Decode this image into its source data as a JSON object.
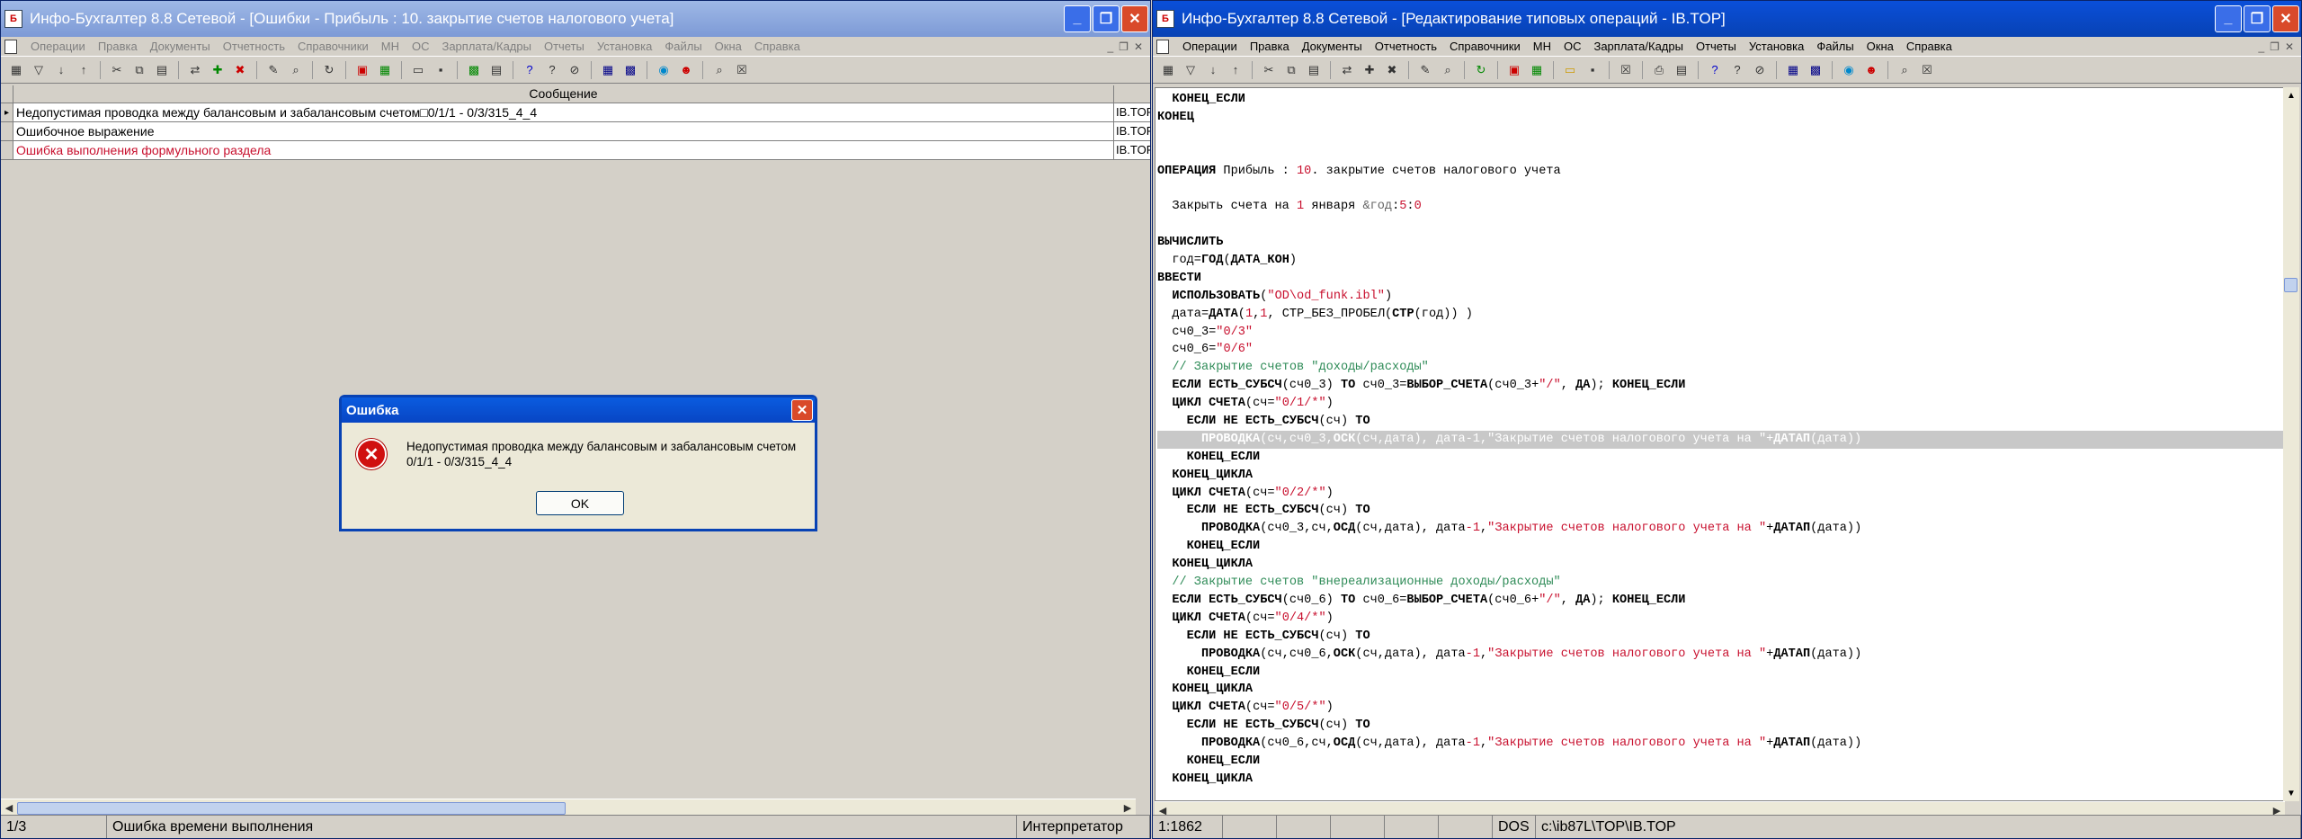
{
  "left": {
    "title": "Инфо-Бухгалтер 8.8 Сетевой - [Ошибки - Прибыль : 10. закрытие счетов налогового учета]",
    "menu": [
      "Операции",
      "Правка",
      "Документы",
      "Отчетность",
      "Справочники",
      "МН",
      "ОС",
      "Зарплата/Кадры",
      "Отчеты",
      "Установка",
      "Файлы",
      "Окна",
      "Справка"
    ],
    "grid": {
      "header": "Сообщение",
      "rows": [
        {
          "message": "Недопустимая проводка между балансовым и забалансовым счетом□0/1/1 - 0/3/315_4_4",
          "source": "IB.TOP",
          "error": false
        },
        {
          "message": "Ошибочное выражение",
          "source": "IB.TOP",
          "error": false
        },
        {
          "message": "Ошибка выполнения формульного раздела",
          "source": "IB.TOP",
          "error": true
        }
      ]
    },
    "status": {
      "position": "1/3",
      "message": "Ошибка времени выполнения",
      "mode": "Интерпретатор"
    }
  },
  "dialog": {
    "title": "Ошибка",
    "line1": "Недопустимая проводка между балансовым и забалансовым счетом",
    "line2": "0/1/1 - 0/3/315_4_4",
    "ok_label": "OK"
  },
  "right": {
    "title": "Инфо-Бухгалтер 8.8 Сетевой - [Редактирование типовых операций - IB.TOP]",
    "menu": [
      "Операции",
      "Правка",
      "Документы",
      "Отчетность",
      "Справочники",
      "МН",
      "ОС",
      "Зарплата/Кадры",
      "Отчеты",
      "Установка",
      "Файлы",
      "Окна",
      "Справка"
    ],
    "status": {
      "cursor": "1:1862",
      "encoding": "DOS",
      "path": "c:\\ib87L\\TOP\\IB.TOP"
    }
  },
  "colors": {
    "title_active": "#0842b4",
    "title_inactive": "#7d9ad6",
    "keyword_red": "#c8102e",
    "comment_green": "#2e8b57"
  }
}
